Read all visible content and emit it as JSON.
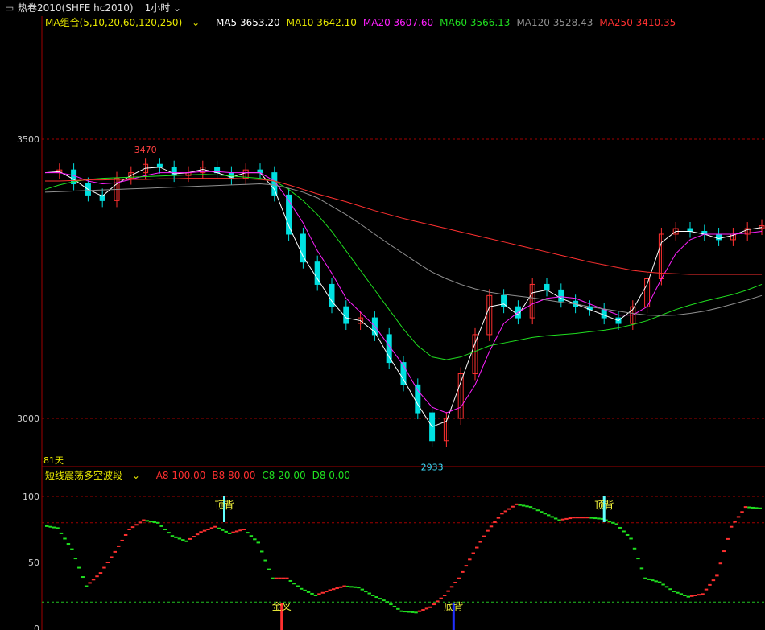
{
  "titlebar": {
    "icon": "window-icon",
    "symbol": "热卷2010(SHFE hc2010)",
    "period": "1小时",
    "chevron": "chevron-down-icon"
  },
  "ma_legend": {
    "group": "MA组合(5,10,20,60,120,250)",
    "items": [
      {
        "label": "MA5",
        "value": "3653.20",
        "color": "#ffffff"
      },
      {
        "label": "MA10",
        "value": "3642.10",
        "color": "#e8e800"
      },
      {
        "label": "MA20",
        "value": "3607.60",
        "color": "#ff20ff"
      },
      {
        "label": "MA60",
        "value": "3566.13",
        "color": "#20e020"
      },
      {
        "label": "MA120",
        "value": "3528.43",
        "color": "#909090"
      },
      {
        "label": "MA250",
        "value": "3410.35",
        "color": "#ff3030"
      }
    ]
  },
  "indicator_legend": {
    "name": "短线震荡多空波段",
    "items": [
      {
        "label": "A8",
        "value": "100.00",
        "color": "#ff3030"
      },
      {
        "label": "B8",
        "value": "80.00",
        "color": "#ff3030"
      },
      {
        "label": "C8",
        "value": "20.00",
        "color": "#20e020"
      },
      {
        "label": "D8",
        "value": "0.00",
        "color": "#20e020"
      }
    ]
  },
  "colors": {
    "up": "#ff3030",
    "down": "#00e0e0",
    "grid": "#a00000",
    "axis": "#a00000"
  },
  "chart_data": [
    {
      "type": "line",
      "name": "price",
      "y_ticks": [
        "3500",
        "3000"
      ],
      "ylim": [
        2900,
        3700
      ],
      "annotations": [
        {
          "text": "3470",
          "value": 3470
        },
        {
          "text": "2933",
          "value": 2933
        }
      ],
      "bottom_label": "81天",
      "x": [
        0,
        4,
        8,
        12,
        16,
        20,
        24,
        28,
        32,
        36,
        40,
        44,
        48,
        52,
        56,
        60,
        64,
        68,
        72,
        76,
        80,
        84,
        88,
        92,
        96,
        100,
        104,
        108,
        112,
        116,
        120,
        124,
        128,
        132,
        136,
        140,
        144,
        148,
        152,
        156,
        160,
        164,
        168,
        172,
        176,
        180,
        184,
        188,
        192,
        196,
        200
      ],
      "series": [
        {
          "name": "price",
          "values": [
            3440,
            3445,
            3420,
            3400,
            3390,
            3430,
            3440,
            3455,
            3450,
            3435,
            3440,
            3450,
            3440,
            3430,
            3445,
            3440,
            3400,
            3330,
            3280,
            3240,
            3200,
            3170,
            3180,
            3150,
            3100,
            3060,
            3010,
            2960,
            3000,
            3080,
            3150,
            3220,
            3200,
            3180,
            3240,
            3230,
            3210,
            3200,
            3195,
            3180,
            3170,
            3200,
            3250,
            3330,
            3340,
            3335,
            3330,
            3320,
            3330,
            3340,
            3345
          ]
        },
        {
          "name": "MA5",
          "values": [
            3440,
            3442,
            3428,
            3410,
            3398,
            3420,
            3435,
            3448,
            3450,
            3438,
            3440,
            3446,
            3440,
            3432,
            3440,
            3440,
            3410,
            3345,
            3290,
            3250,
            3210,
            3180,
            3175,
            3155,
            3110,
            3070,
            3025,
            2985,
            2995,
            3065,
            3135,
            3200,
            3205,
            3185,
            3225,
            3230,
            3215,
            3205,
            3195,
            3185,
            3175,
            3195,
            3240,
            3315,
            3335,
            3335,
            3330,
            3322,
            3328,
            3338,
            3342
          ]
        },
        {
          "name": "MA20",
          "values": [
            3440,
            3440,
            3435,
            3425,
            3420,
            3422,
            3428,
            3435,
            3440,
            3440,
            3440,
            3442,
            3442,
            3440,
            3440,
            3440,
            3425,
            3390,
            3350,
            3300,
            3260,
            3215,
            3190,
            3165,
            3130,
            3095,
            3050,
            3020,
            3010,
            3020,
            3060,
            3120,
            3170,
            3190,
            3205,
            3215,
            3218,
            3215,
            3205,
            3195,
            3185,
            3185,
            3200,
            3250,
            3295,
            3320,
            3330,
            3330,
            3330,
            3332,
            3335
          ]
        },
        {
          "name": "MA60",
          "values": [
            3410,
            3418,
            3424,
            3428,
            3430,
            3431,
            3432,
            3433,
            3434,
            3435,
            3436,
            3437,
            3436,
            3434,
            3432,
            3430,
            3425,
            3410,
            3390,
            3365,
            3335,
            3300,
            3265,
            3230,
            3195,
            3160,
            3130,
            3110,
            3105,
            3110,
            3120,
            3130,
            3135,
            3140,
            3145,
            3148,
            3150,
            3152,
            3155,
            3158,
            3162,
            3168,
            3175,
            3185,
            3195,
            3203,
            3210,
            3216,
            3222,
            3230,
            3240
          ]
        },
        {
          "name": "MA120",
          "values": [
            3405,
            3406,
            3407,
            3408,
            3409,
            3410,
            3411,
            3412,
            3413,
            3414,
            3415,
            3416,
            3417,
            3418,
            3419,
            3420,
            3418,
            3412,
            3405,
            3395,
            3380,
            3365,
            3348,
            3330,
            3312,
            3295,
            3278,
            3262,
            3250,
            3240,
            3232,
            3226,
            3222,
            3219,
            3216,
            3212,
            3208,
            3205,
            3200,
            3196,
            3192,
            3188,
            3185,
            3184,
            3185,
            3188,
            3192,
            3198,
            3205,
            3212,
            3220
          ]
        },
        {
          "name": "MA250",
          "values": [
            3425,
            3425,
            3426,
            3427,
            3427,
            3428,
            3428,
            3428,
            3429,
            3429,
            3430,
            3430,
            3430,
            3430,
            3429,
            3428,
            3425,
            3418,
            3410,
            3402,
            3395,
            3388,
            3380,
            3372,
            3365,
            3358,
            3352,
            3346,
            3340,
            3334,
            3328,
            3322,
            3316,
            3310,
            3304,
            3298,
            3292,
            3286,
            3280,
            3275,
            3270,
            3265,
            3262,
            3260,
            3259,
            3258,
            3258,
            3258,
            3258,
            3258,
            3258
          ]
        }
      ]
    },
    {
      "type": "line",
      "name": "短线震荡多空波段",
      "y_ticks": [
        "100",
        "50",
        "0"
      ],
      "ylim": [
        0,
        100
      ],
      "reference_lines": [
        100,
        80,
        20
      ],
      "signals": [
        {
          "text": "顶背",
          "x": 50,
          "color": "#ffff40"
        },
        {
          "text": "金叉",
          "x": 66,
          "color": "#ffff40"
        },
        {
          "text": "底背",
          "x": 114,
          "color": "#ffff40"
        },
        {
          "text": "顶背",
          "x": 156,
          "color": "#ffff40"
        }
      ],
      "x": [
        0,
        4,
        8,
        12,
        16,
        20,
        24,
        28,
        32,
        36,
        40,
        44,
        48,
        52,
        56,
        60,
        64,
        68,
        72,
        76,
        80,
        84,
        88,
        92,
        96,
        100,
        104,
        108,
        112,
        116,
        120,
        124,
        128,
        132,
        136,
        140,
        144,
        148,
        152,
        156,
        160,
        164,
        168,
        172,
        176,
        180,
        184,
        188,
        192,
        196,
        200
      ],
      "values": [
        78,
        76,
        60,
        32,
        42,
        58,
        75,
        82,
        80,
        70,
        66,
        73,
        77,
        72,
        75,
        65,
        38,
        38,
        30,
        25,
        29,
        32,
        31,
        25,
        20,
        13,
        12,
        16,
        25,
        38,
        57,
        74,
        87,
        94,
        92,
        87,
        82,
        84,
        84,
        83,
        79,
        68,
        38,
        35,
        28,
        24,
        26,
        40,
        77,
        92,
        91
      ]
    }
  ]
}
